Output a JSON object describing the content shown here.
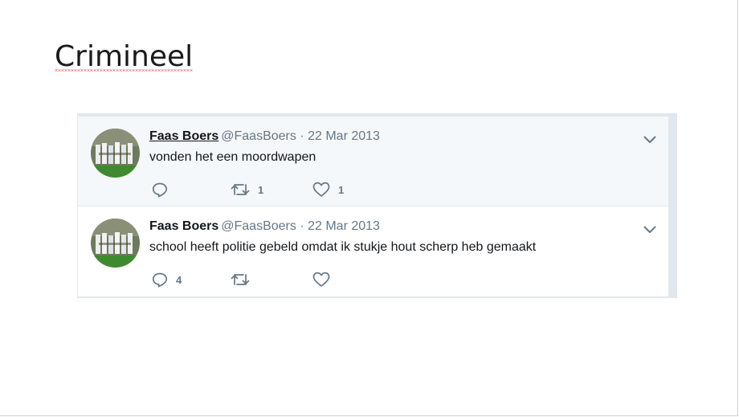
{
  "slide": {
    "title": "Crimineel"
  },
  "tweets": [
    {
      "name": "Faas Boers",
      "meta": "@FaasBoers · 22 Mar 2013",
      "text": "vonden het een moordwapen",
      "reply_count": "",
      "retweet_count": "1",
      "like_count": "1"
    },
    {
      "name": "Faas Boers",
      "meta": "@FaasBoers · 22 Mar 2013",
      "text": "school heeft politie gebeld omdat ik stukje hout scherp heb gemaakt",
      "reply_count": "4",
      "retweet_count": "",
      "like_count": ""
    }
  ],
  "colors": {
    "name": "#14171a",
    "meta": "#657786",
    "highlight_bg": "#f5f8fa",
    "border": "#e1e8ed",
    "spellcheck_underline": "#e02020"
  },
  "icons": {
    "reply": "reply-icon",
    "retweet": "retweet-icon",
    "like": "heart-icon",
    "more": "chevron-down-icon"
  }
}
